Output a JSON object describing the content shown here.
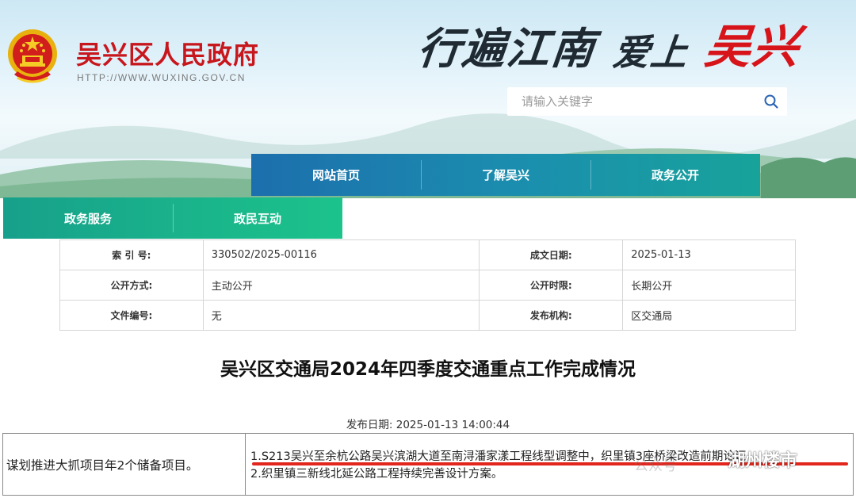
{
  "header": {
    "site_name": "吴兴区人民政府",
    "site_url": "HTTP://WWW.WUXING.GOV.CN",
    "slogan_part1": "行遍江南",
    "slogan_part2": "爱上",
    "slogan_part3": "吴兴",
    "emblem_icon": "national-emblem-icon",
    "search": {
      "placeholder": "请输入关键字",
      "value": ""
    }
  },
  "nav": {
    "primary": [
      {
        "label": "网站首页"
      },
      {
        "label": "了解吴兴"
      },
      {
        "label": "政务公开"
      }
    ],
    "secondary": [
      {
        "label": "政务服务"
      },
      {
        "label": "政民互动"
      }
    ]
  },
  "info": {
    "index_label": "索 引 号:",
    "index_value": "330502/2025-00116",
    "date_label": "成文日期:",
    "date_value": "2025-01-13",
    "mode_label": "公开方式:",
    "mode_value": "主动公开",
    "period_label": "公开时限:",
    "period_value": "长期公开",
    "docno_label": "文件编号:",
    "docno_value": "无",
    "org_label": "发布机构:",
    "org_value": "区交通局"
  },
  "document": {
    "title": "吴兴区交通局2024年四季度交通重点工作完成情况",
    "publish_date": "发布日期: 2025-01-13 14:00:44"
  },
  "row": {
    "left": "谋划推进大抓项目年2个储备项目。",
    "line1": "1.S213吴兴至余杭公路吴兴滨湖大道至南浔潘家漾工程线型调整中，织里镇3座桥梁改造前期论证",
    "line2": "2.织里镇三新线北延公路工程持续完善设计方案。"
  },
  "overlay": {
    "watermark_faint": "公众号",
    "watermark": "湖州楼市"
  },
  "colors": {
    "site_red": "#c8161d",
    "nav_primary": "#1b8fae",
    "nav_secondary": "#1cc38b",
    "underline_red": "#e3261d"
  }
}
